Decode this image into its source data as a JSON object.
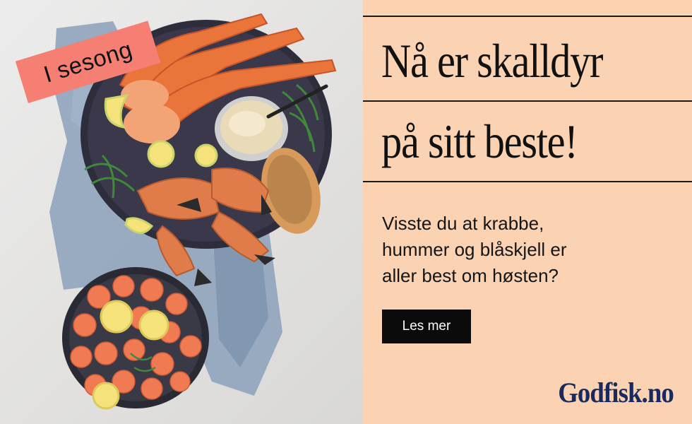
{
  "badge": {
    "text": "I sesong"
  },
  "headline": {
    "line1": "Nå er skalldyr",
    "line2": "på sitt beste!"
  },
  "body": {
    "line1": "Visste du at krabbe,",
    "line2": "hummer og blåskjell er",
    "line3": "aller best om høsten?"
  },
  "cta": {
    "label": "Les mer"
  },
  "brand": {
    "logo_text": "Godfisk.no"
  },
  "colors": {
    "panel_background": "#fbd3b3",
    "badge_background": "#f57f72",
    "cta_background": "#0b0b0b",
    "logo": "#1a2a5c"
  },
  "photo": {
    "icon": "seafood-platter-image"
  }
}
